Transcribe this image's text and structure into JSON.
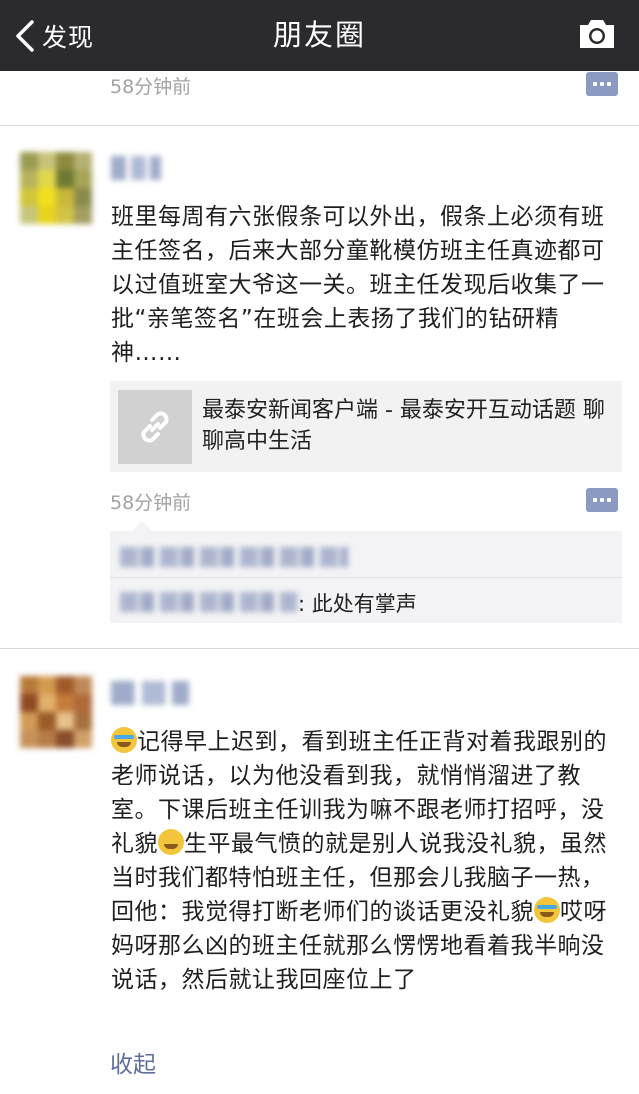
{
  "navbar": {
    "back_label": "发现",
    "title": "朋友圈"
  },
  "post_prev": {
    "time": "58分钟前"
  },
  "post1": {
    "text": "班里每周有六张假条可以外出，假条上必须有班主任签名，后来大部分童靴模仿班主任真迹都可以过值班室大爷这一关。班主任发现后收集了一批“亲笔签名”在班会上表扬了我们的钻研精神……",
    "link_title": "最泰安新闻客户端 - 最泰安开互动话题 聊聊高中生活",
    "time": "58分钟前",
    "comment_text": ": 此处有掌声"
  },
  "post2": {
    "segments": [
      "记得早上迟到，看到班主任正背对着我跟别的老师说话，以为他没看到我，就悄悄溜进了教室。下课后班主任训我为嘛不跟老师打招呼，没礼貌",
      "生平最气愤的就是别人说我没礼貌，虽然当时我们都特怕班主任，但那会儿我脑子一热，回他：我觉得打断老师们的谈话更没礼貌",
      "哎呀妈呀那么凶的班主任就那么愣愣地看着我半晌没说话，然后就让我回座位上了"
    ],
    "collapse_label": "收起"
  },
  "icons": {
    "back": "chevron-left-icon",
    "camera": "camera-icon",
    "comment": "comment-bubble-icon",
    "link": "link-icon"
  },
  "colors": {
    "navbar_bg": "#2b2a2f",
    "link_blue": "#5e6f9c",
    "comment_btn": "#8b9ac1"
  }
}
